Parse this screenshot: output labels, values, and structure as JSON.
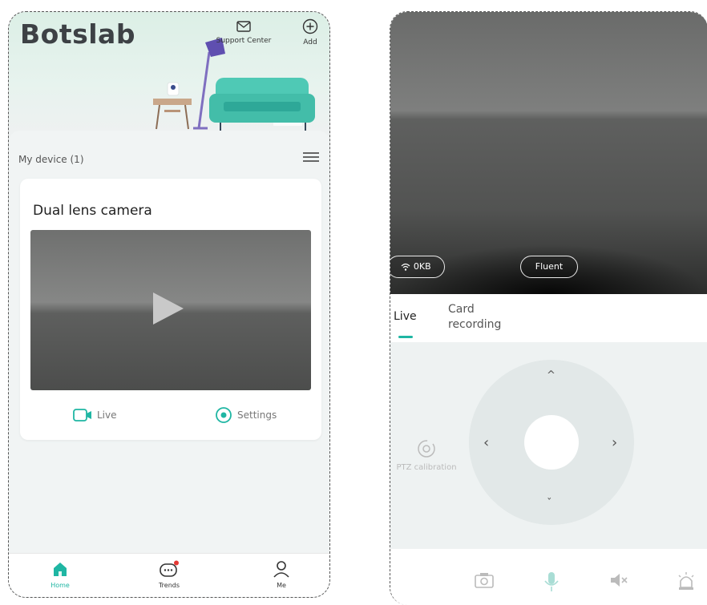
{
  "left": {
    "brand": "Botslab",
    "header": {
      "support_label": "Support Center",
      "add_label": "Add"
    },
    "devices": {
      "section_label": "My device  (1)",
      "camera": {
        "name": "Dual lens camera",
        "live_label": "Live",
        "settings_label": "Settings"
      }
    },
    "nav": [
      {
        "label": "Home",
        "icon": "home-icon",
        "active": true
      },
      {
        "label": "Trends",
        "icon": "chat-icon",
        "badge": true
      },
      {
        "label": "Me",
        "icon": "user-icon"
      }
    ]
  },
  "right": {
    "video": {
      "network_speed": "0KB",
      "quality": "Fluent"
    },
    "tabs": [
      {
        "label": "Live",
        "active": true
      },
      {
        "label": "Card\nrecording"
      }
    ],
    "ptz": {
      "calibration_label": "PTZ calibration",
      "arrows": {
        "up": "^",
        "down": "ˇ",
        "left": "‹",
        "right": "›"
      }
    },
    "toolbar": [
      "camera-icon",
      "mic-icon",
      "mute-icon",
      "alarm-icon"
    ]
  },
  "colors": {
    "accent": "#1fb6a3",
    "badge": "#e53935"
  }
}
